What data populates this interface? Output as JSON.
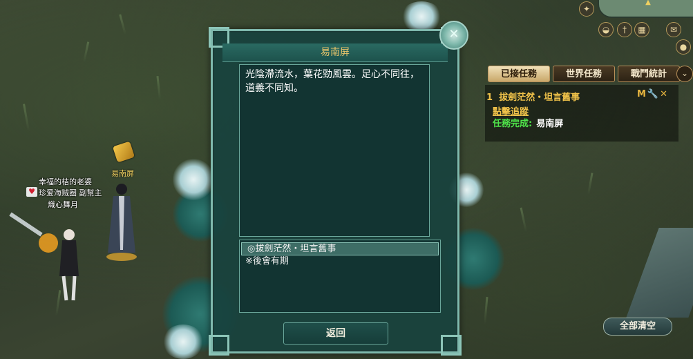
{
  "dialog": {
    "title": "易南屏",
    "body_text": "光陰滯流水，葉花勁風雲。足心不同往，道義不同知。",
    "options": [
      "◎拔劍茫然・坦言舊事",
      "※後會有期"
    ],
    "back_label": "返回"
  },
  "world": {
    "npc_name": "易南屏",
    "player_lines": [
      "幸福的桔的老婆",
      "珍爱海贼圈 副幫主",
      "熾心舞月"
    ]
  },
  "quest_tracker": {
    "tabs": [
      "已接任務",
      "世界任務",
      "戰鬥統計"
    ],
    "active_tab": "已接任務",
    "quest_index": "1",
    "quest_name": "拔劍茫然・坦言舊事",
    "quest_icons": "M🔧✕",
    "track_link": "點擊追蹤",
    "done_label": "任務完成:",
    "done_target": "易南屏",
    "clear_all": "全部清空"
  },
  "colors": {
    "dialog_bg": "#18423e",
    "dialog_border": "#7fb9ad",
    "title_gold": "#e9c46a",
    "quest_gold": "#f0c24a",
    "quest_green": "#4fe34a"
  }
}
